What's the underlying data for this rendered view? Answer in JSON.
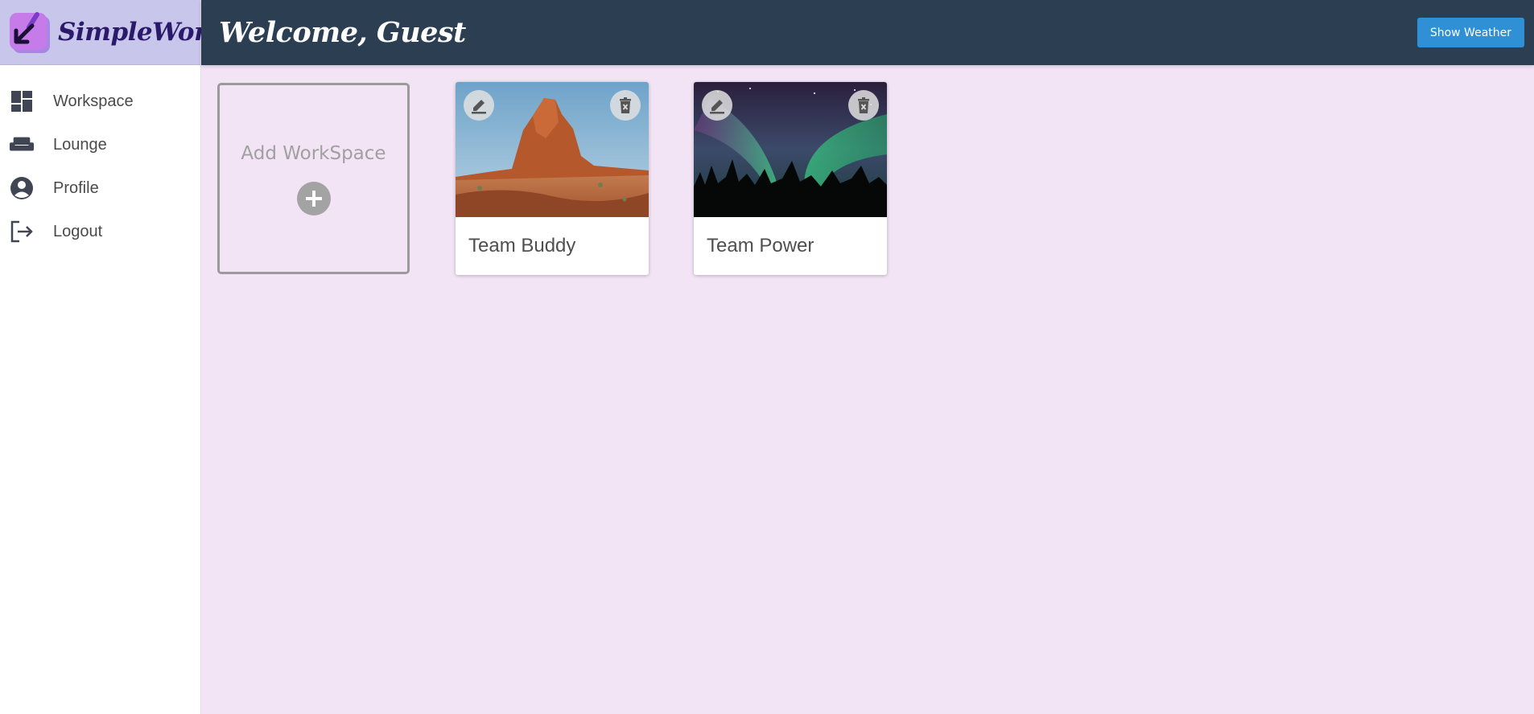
{
  "app": {
    "name": "SimpleWork",
    "logo_icon": "pencil-arrow-logo-icon"
  },
  "header": {
    "welcome": "Welcome, Guest",
    "weather_button": "Show Weather"
  },
  "sidebar": {
    "items": [
      {
        "label": "Workspace",
        "icon": "dashboard-icon"
      },
      {
        "label": "Lounge",
        "icon": "sofa-icon"
      },
      {
        "label": "Profile",
        "icon": "account-circle-icon"
      },
      {
        "label": "Logout",
        "icon": "logout-icon"
      }
    ]
  },
  "add_workspace": {
    "label": "Add WorkSpace",
    "icon": "plus-circle-icon"
  },
  "workspaces": [
    {
      "title": "Team Buddy",
      "image": "desert-rock-formation",
      "edit_icon": "pencil-icon",
      "delete_icon": "trash-icon"
    },
    {
      "title": "Team Power",
      "image": "aurora-forest",
      "edit_icon": "pencil-icon",
      "delete_icon": "trash-icon"
    }
  ],
  "colors": {
    "background": "#f2e4f5",
    "header": "#2c3e52",
    "brand_bar": "#c9c6eb",
    "button": "#2f90d6",
    "sidebar_icon": "#3f4552"
  }
}
